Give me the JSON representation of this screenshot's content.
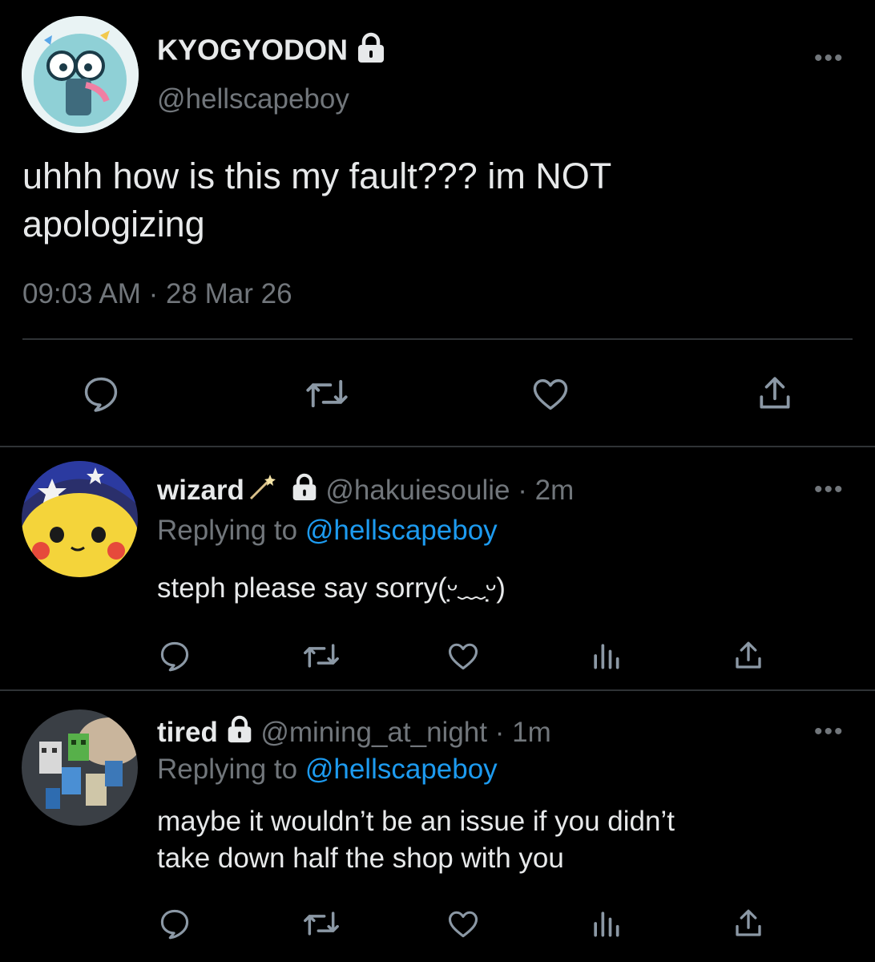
{
  "main_tweet": {
    "display_name": "KYOGYODON",
    "handle": "@hellscapeboy",
    "text_line1": "uhhh how is this my fault??? im NOT",
    "text_line2": "apologizing",
    "timestamp": "09:03 AM · 28 Mar 26"
  },
  "replies": [
    {
      "display_name": "wizard",
      "handle": "@hakuiesoulie",
      "time": "· 2m",
      "replying_label": "Replying to",
      "replying_to": "@hellscapeboy",
      "text": "steph please say sorry(ᵕ̣̣̣̣̣̣﹏ᵕ̣̣̣̣̣̣)"
    },
    {
      "display_name": "tired",
      "handle": "@mining_at_night",
      "time": "· 1m",
      "replying_label": "Replying to",
      "replying_to": "@hellscapeboy",
      "text_line1": "maybe it wouldn’t be an issue if you didn’t",
      "text_line2": "take down half the shop with you"
    }
  ],
  "more_label": "•••",
  "colors": {
    "background": "#000000",
    "text": "#e7e9ea",
    "muted": "#71767b",
    "link": "#1d9bf0",
    "divider": "#2f3336"
  },
  "icons": [
    "reply-icon",
    "retweet-icon",
    "like-icon",
    "views-icon",
    "share-icon",
    "lock-icon"
  ]
}
